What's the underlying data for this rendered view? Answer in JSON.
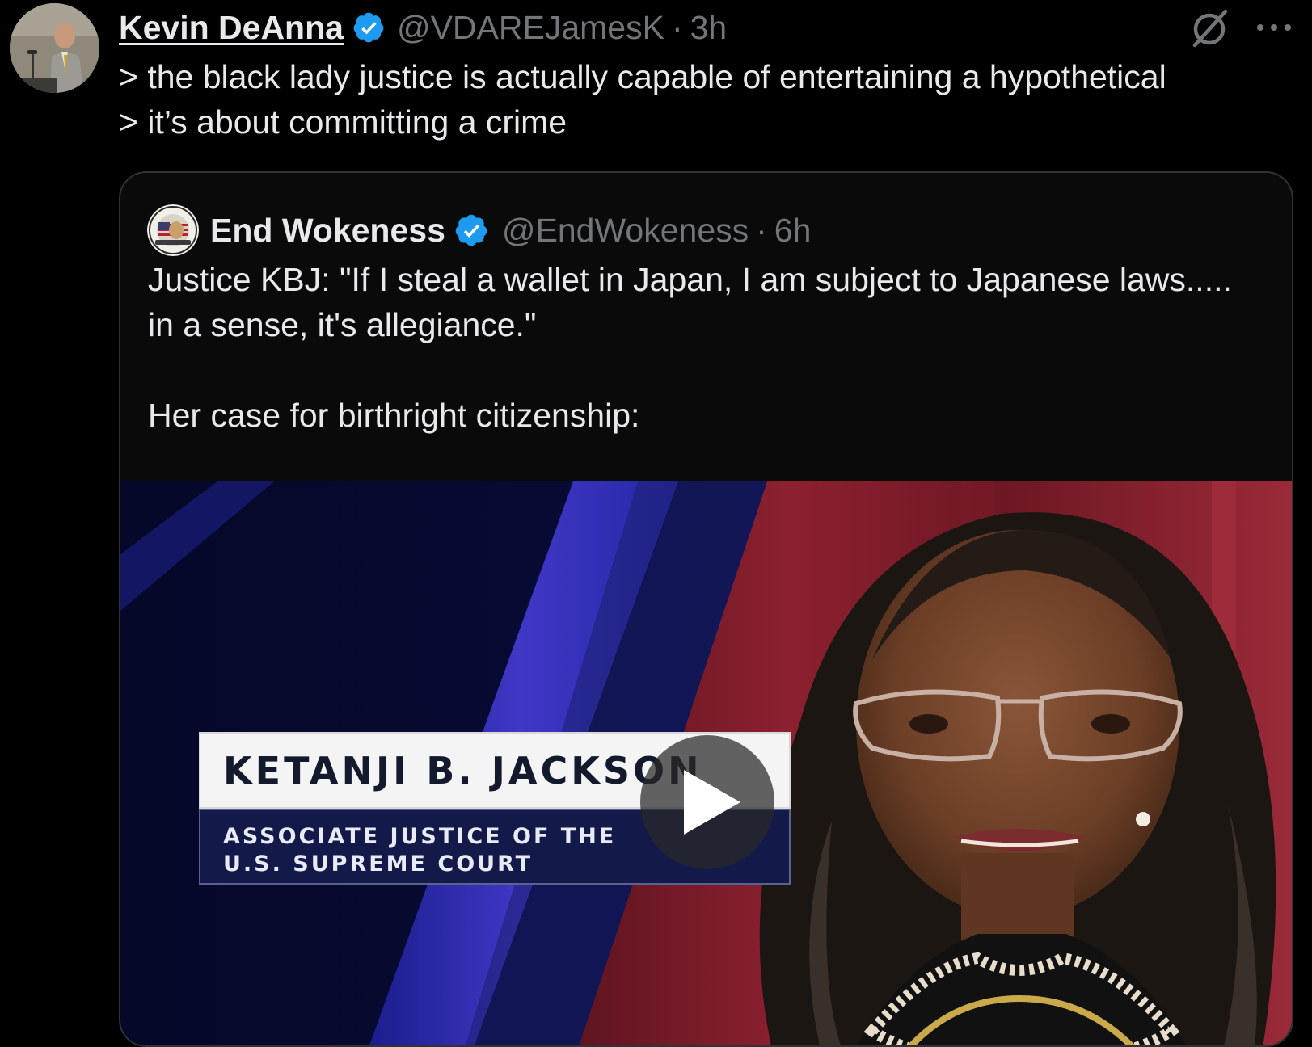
{
  "tweet": {
    "author": {
      "display_name": "Kevin DeAnna",
      "handle": "@VDAREJamesK",
      "separator": "·",
      "time": "3h"
    },
    "text_lines": [
      "> the black lady justice is actually capable of entertaining a hypothetical",
      "> it’s about committing a crime"
    ],
    "icons": [
      "verified-badge-icon",
      "grok-icon",
      "more-icon"
    ]
  },
  "quoted_tweet": {
    "author": {
      "display_name": "End Wokeness",
      "handle": "@EndWokeness",
      "separator": "·",
      "time": "6h"
    },
    "text_lines": [
      "Justice KBJ: \"If I steal a wallet in Japan, I am subject to Japanese laws.....",
      "in a sense, it's allegiance.\""
    ],
    "text_line_2": "Her case for birthright citizenship:",
    "video": {
      "lower_third_name": "KETANJI B. JACKSON",
      "lower_third_title_lines": [
        "ASSOCIATE JUSTICE OF THE",
        "U.S. SUPREME COURT"
      ]
    }
  },
  "colors": {
    "background": "#000000",
    "text": "#e7e9ea",
    "muted": "#71767b",
    "verified": "#1d9bf0",
    "border": "#2f3336"
  }
}
